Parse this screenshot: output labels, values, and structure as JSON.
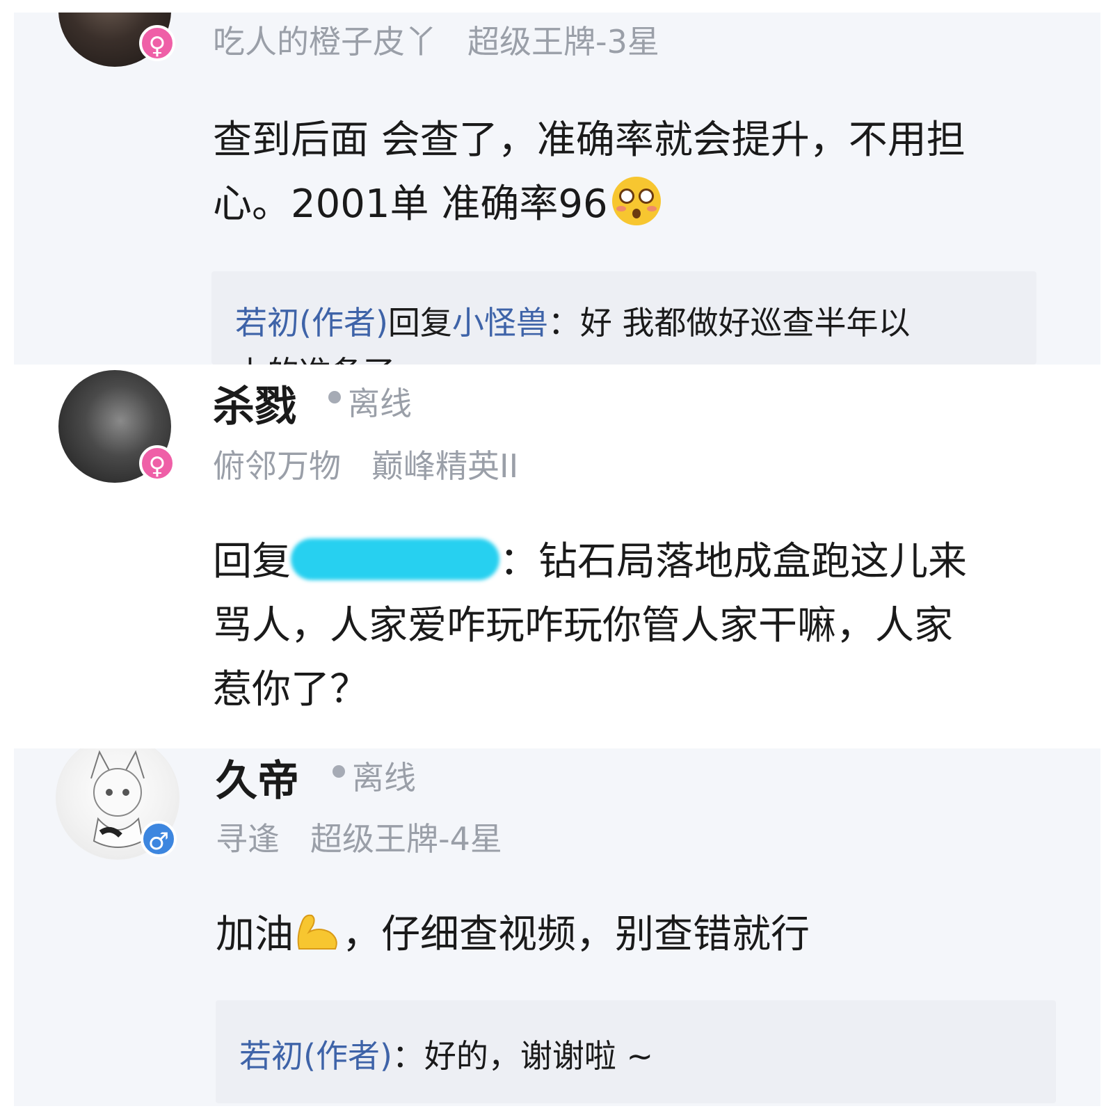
{
  "comments": [
    {
      "user": "吃人的橙子皮丫",
      "rank": "超级王牌-3星",
      "gender_symbol": "♀",
      "body_lines": [
        "查到后面 会查了，准确率就会提升，不用担",
        "心。2001单 准确率96"
      ],
      "reply": {
        "author": "若初(作者)",
        "verb": "回复",
        "target": "小怪兽",
        "text": "：好 我都做好巡查半年以",
        "overflow_text": "上的准备了"
      }
    },
    {
      "user": "杀戮",
      "status": "离线",
      "title": "俯邻万物",
      "rank": "巅峰精英II",
      "gender_symbol": "♀",
      "reply_prefix": "回复",
      "body_lines_tail": "：钻石局落地成盒跑这儿来",
      "body_lines": [
        "骂人，人家爱咋玩咋玩你管人家干嘛，人家",
        "惹你了？"
      ]
    },
    {
      "user": "久帝",
      "status": "离线",
      "title": "寻逢",
      "rank": "超级王牌-4星",
      "gender_symbol": "♂",
      "body_prefix": "加油",
      "body_suffix": "，仔细查视频，别查错就行",
      "reply": {
        "author": "若初(作者)",
        "text": "：好的，谢谢啦 ~"
      }
    }
  ],
  "colors": {
    "link": "#3e63a8",
    "muted": "#9a9fa8",
    "female": "#ef5fa7",
    "male": "#3d86df",
    "redaction": "#27d0f0"
  },
  "icons": [
    "female-icon",
    "male-icon",
    "astonished-face-emoji",
    "flexed-biceps-emoji",
    "status-dot"
  ]
}
